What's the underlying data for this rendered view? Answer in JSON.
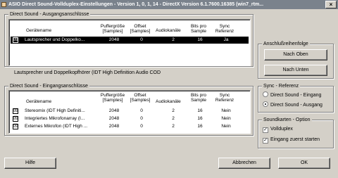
{
  "window": {
    "title": "ASIO Direct Sound-Vollduplex-Einstellungen - Version 1, 0, 1, 14 - DirectX Version 6.1.7600.16385 (win7_rtm...",
    "close_label": "×"
  },
  "output_group": {
    "title": "Direct Sound - Ausgangsanschlüsse",
    "headers": {
      "name": "Gerätename",
      "buffer": "Puffergröße [Samples]",
      "offset": "Offset [Samples]",
      "channels": "Audiokanäle",
      "bits": "Bits pro Sample",
      "sync": "Sync Referenz"
    },
    "rows": [
      {
        "check": "☒",
        "name": "Lautsprecher und Doppelko...",
        "buffer": "2048",
        "offset": "0",
        "channels": "2",
        "bits": "16",
        "sync": "Ja"
      }
    ]
  },
  "status_text": "Lautsprecher und Doppelkopfhörer (IDT High Definition Audio COD",
  "input_group": {
    "title": "Direct Sound - Eingangsanschlüsse",
    "headers": {
      "name": "Gerätename",
      "buffer": "Puffergröße [Samples]",
      "offset": "Offset [Samples]",
      "channels": "Audiokanäle",
      "bits": "Bits pro Sample",
      "sync": "Sync Referenz"
    },
    "rows": [
      {
        "check": "☒",
        "name": "Stereomix (IDT High Definiti...",
        "buffer": "2048",
        "offset": "0",
        "channels": "2",
        "bits": "16",
        "sync": "Nein"
      },
      {
        "check": "☒",
        "name": "Integriertes Mikrofonarray (I...",
        "buffer": "2048",
        "offset": "0",
        "channels": "2",
        "bits": "16",
        "sync": "Nein"
      },
      {
        "check": "☒",
        "name": "Externes Mikrofon (IDT High ...",
        "buffer": "2048",
        "offset": "0",
        "channels": "2",
        "bits": "16",
        "sync": "Nein"
      }
    ]
  },
  "order_group": {
    "title": "Anschlußreihenfolge",
    "up_label": "Nach Oben",
    "down_label": "Nach Unten"
  },
  "sync_group": {
    "title": "Sync - Referenz",
    "options": [
      {
        "label": "Direct Sound - Eingang",
        "selected": false
      },
      {
        "label": "Direct Sound - Ausgang",
        "selected": true
      }
    ]
  },
  "soundcard_group": {
    "title": "Soundkarten - Option",
    "options": [
      {
        "label": "Vollduplex",
        "checked": true,
        "mark": "✓"
      },
      {
        "label": "Eingang zuerst starten",
        "checked": true,
        "mark": "✓"
      }
    ]
  },
  "footer": {
    "help_label": "Hilfe",
    "cancel_label": "Abbrechen",
    "ok_label": "OK"
  }
}
